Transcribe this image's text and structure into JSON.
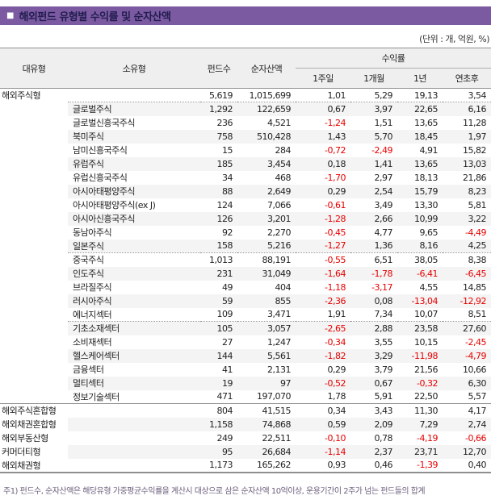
{
  "header": {
    "bullet": "■",
    "title": "해외펀드 유형별 수익률 및 순자산액",
    "unit_note": "(단위 : 개, 억원, %)"
  },
  "colors": {
    "accent_purple": "#7b5aa1",
    "title_text": "#221d4f",
    "negative_red": "#e60000",
    "stripe_gray": "#f4f4f4",
    "line_gray": "#8f8f8f"
  },
  "table": {
    "columns": {
      "major": "대유형",
      "minor": "소유형",
      "funds": "펀드수",
      "nav": "순자산액",
      "returns_group": "수익률",
      "r1w": "1주일",
      "r1m": "1개월",
      "r1y": "1년",
      "rytd": "연초후"
    },
    "rows": [
      {
        "major": "해외주식형",
        "minor": "",
        "funds": "5,619",
        "nav": "1,015,699",
        "r1w": "1,01",
        "r1m": "5,29",
        "r1y": "19,13",
        "rytd": "3,54",
        "shaded": false,
        "sep": ""
      },
      {
        "major": "",
        "minor": "글로벌주식",
        "funds": "1,292",
        "nav": "122,659",
        "r1w": "0,67",
        "r1m": "3,97",
        "r1y": "22,65",
        "rytd": "6,16",
        "shaded": true,
        "sep": "dotted"
      },
      {
        "major": "",
        "minor": "글로벌신흥국주식",
        "funds": "236",
        "nav": "4,521",
        "r1w": "-1,24",
        "r1m": "1,51",
        "r1y": "13,65",
        "rytd": "11,28",
        "shaded": false,
        "sep": ""
      },
      {
        "major": "",
        "minor": "북미주식",
        "funds": "758",
        "nav": "510,428",
        "r1w": "1,43",
        "r1m": "5,70",
        "r1y": "18,45",
        "rytd": "1,97",
        "shaded": true,
        "sep": ""
      },
      {
        "major": "",
        "minor": "남미신흥국주식",
        "funds": "15",
        "nav": "284",
        "r1w": "-0,72",
        "r1m": "-2,49",
        "r1y": "4,91",
        "rytd": "15,82",
        "shaded": false,
        "sep": ""
      },
      {
        "major": "",
        "minor": "유럽주식",
        "funds": "185",
        "nav": "3,454",
        "r1w": "0,18",
        "r1m": "1,41",
        "r1y": "13,65",
        "rytd": "13,03",
        "shaded": true,
        "sep": ""
      },
      {
        "major": "",
        "minor": "유럽신흥국주식",
        "funds": "34",
        "nav": "468",
        "r1w": "-1,70",
        "r1m": "2,97",
        "r1y": "18,13",
        "rytd": "21,86",
        "shaded": false,
        "sep": ""
      },
      {
        "major": "",
        "minor": "아시아태평양주식",
        "funds": "88",
        "nav": "2,649",
        "r1w": "0,29",
        "r1m": "2,54",
        "r1y": "15,79",
        "rytd": "8,23",
        "shaded": true,
        "sep": ""
      },
      {
        "major": "",
        "minor": "아시아태평양주식(ex J)",
        "funds": "124",
        "nav": "7,066",
        "r1w": "-0,61",
        "r1m": "3,49",
        "r1y": "13,30",
        "rytd": "5,81",
        "shaded": false,
        "sep": ""
      },
      {
        "major": "",
        "minor": "아시아신흥국주식",
        "funds": "126",
        "nav": "3,201",
        "r1w": "-1,28",
        "r1m": "2,66",
        "r1y": "10,99",
        "rytd": "3,22",
        "shaded": true,
        "sep": ""
      },
      {
        "major": "",
        "minor": "동남아주식",
        "funds": "92",
        "nav": "2,270",
        "r1w": "-0,45",
        "r1m": "4,77",
        "r1y": "9,65",
        "rytd": "-4,49",
        "shaded": false,
        "sep": ""
      },
      {
        "major": "",
        "minor": "일본주식",
        "funds": "158",
        "nav": "5,216",
        "r1w": "-1,27",
        "r1m": "1,36",
        "r1y": "8,16",
        "rytd": "4,25",
        "shaded": true,
        "sep": ""
      },
      {
        "major": "",
        "minor": "중국주식",
        "funds": "1,013",
        "nav": "88,191",
        "r1w": "-0,55",
        "r1m": "6,51",
        "r1y": "38,05",
        "rytd": "8,38",
        "shaded": false,
        "sep": "dotted"
      },
      {
        "major": "",
        "minor": "인도주식",
        "funds": "231",
        "nav": "31,049",
        "r1w": "-1,64",
        "r1m": "-1,78",
        "r1y": "-6,41",
        "rytd": "-6,45",
        "shaded": true,
        "sep": ""
      },
      {
        "major": "",
        "minor": "브라질주식",
        "funds": "49",
        "nav": "404",
        "r1w": "-1,18",
        "r1m": "-3,17",
        "r1y": "4,55",
        "rytd": "14,85",
        "shaded": false,
        "sep": ""
      },
      {
        "major": "",
        "minor": "러시아주식",
        "funds": "59",
        "nav": "855",
        "r1w": "-2,36",
        "r1m": "0,08",
        "r1y": "-13,04",
        "rytd": "-12,92",
        "shaded": true,
        "sep": ""
      },
      {
        "major": "",
        "minor": "에너지섹터",
        "funds": "109",
        "nav": "3,471",
        "r1w": "1,91",
        "r1m": "7,34",
        "r1y": "10,07",
        "rytd": "8,51",
        "shaded": false,
        "sep": ""
      },
      {
        "major": "",
        "minor": "기초소재섹터",
        "funds": "105",
        "nav": "3,057",
        "r1w": "-2,65",
        "r1m": "2,88",
        "r1y": "23,58",
        "rytd": "27,60",
        "shaded": true,
        "sep": "dotted"
      },
      {
        "major": "",
        "minor": "소비재섹터",
        "funds": "27",
        "nav": "1,247",
        "r1w": "-0,34",
        "r1m": "3,55",
        "r1y": "10,15",
        "rytd": "-2,45",
        "shaded": false,
        "sep": ""
      },
      {
        "major": "",
        "minor": "헬스케어섹터",
        "funds": "144",
        "nav": "5,561",
        "r1w": "-1,82",
        "r1m": "3,29",
        "r1y": "-11,98",
        "rytd": "-4,79",
        "shaded": true,
        "sep": ""
      },
      {
        "major": "",
        "minor": "금융섹터",
        "funds": "41",
        "nav": "2,131",
        "r1w": "0,29",
        "r1m": "3,79",
        "r1y": "21,56",
        "rytd": "10,66",
        "shaded": false,
        "sep": ""
      },
      {
        "major": "",
        "minor": "멀티섹터",
        "funds": "19",
        "nav": "97",
        "r1w": "-0,52",
        "r1m": "0,67",
        "r1y": "-0,32",
        "rytd": "6,30",
        "shaded": true,
        "sep": ""
      },
      {
        "major": "",
        "minor": "정보기술섹터",
        "funds": "471",
        "nav": "197,070",
        "r1w": "1,78",
        "r1m": "5,91",
        "r1y": "22,50",
        "rytd": "5,57",
        "shaded": false,
        "sep": ""
      },
      {
        "major": "해외주식혼합형",
        "minor": "",
        "funds": "804",
        "nav": "41,515",
        "r1w": "0,34",
        "r1m": "3,43",
        "r1y": "11,30",
        "rytd": "4,17",
        "shaded": false,
        "sep": "solid"
      },
      {
        "major": "해외채권혼합형",
        "minor": "",
        "funds": "1,158",
        "nav": "74,868",
        "r1w": "0,59",
        "r1m": "2,09",
        "r1y": "7,29",
        "rytd": "2,74",
        "shaded": true,
        "sep": ""
      },
      {
        "major": "해외부동산형",
        "minor": "",
        "funds": "249",
        "nav": "22,511",
        "r1w": "-0,10",
        "r1m": "0,78",
        "r1y": "-4,19",
        "rytd": "-0,66",
        "shaded": false,
        "sep": ""
      },
      {
        "major": "커머더티형",
        "minor": "",
        "funds": "95",
        "nav": "26,684",
        "r1w": "-1,14",
        "r1m": "2,37",
        "r1y": "23,71",
        "rytd": "12,70",
        "shaded": true,
        "sep": ""
      },
      {
        "major": "해외채권형",
        "minor": "",
        "funds": "1,173",
        "nav": "165,262",
        "r1w": "0,93",
        "r1m": "0,46",
        "r1y": "-1,39",
        "rytd": "0,40",
        "shaded": false,
        "sep": ""
      }
    ]
  },
  "footnote": "주1) 펀드수, 순자산액은 해당유형 가중평균수익률을 계산시 대상으로 삼은 순자산액 10억이상, 운용기간이 2주가 넘는 펀드들의 합계"
}
